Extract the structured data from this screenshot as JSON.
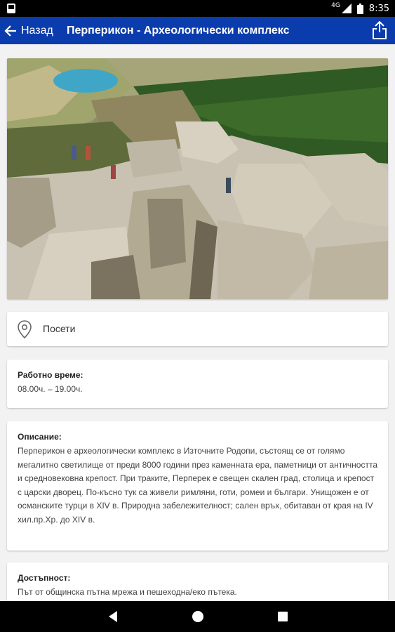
{
  "status_bar": {
    "time": "8:35",
    "network": "4G",
    "left_icon": "notification-icon",
    "icons": [
      "signal-icon",
      "battery-icon"
    ]
  },
  "app_bar": {
    "back_label": "Назад",
    "title": "Перперикон - Археологически комплекс",
    "share_icon": "share-icon",
    "color": "#0b3cae"
  },
  "photo": {
    "subject": "Perperikon archaeological complex rock ruins photo"
  },
  "visit": {
    "icon": "location-pin-icon",
    "label": "Посети"
  },
  "hours": {
    "title": "Работно време:",
    "text": "08.00ч. – 19.00ч."
  },
  "description": {
    "title": "Описание:",
    "text": "Перперикон е археологически комплекс в Източните Родопи, състоящ се от голямо мегалитно светилище от преди 8000 години през каменната ера, паметници от античността и средновековна крепост. При траките, Перперек е свещен скален град, столица и крепост с царски дворец. По-късно тук са живели римляни, готи, ромеи и българи. Унищожен е от османските турци в XIV в. Природна забележителност; сален връх, обитаван от края на IV хил.пр.Хр. до XIV в."
  },
  "accessibility": {
    "title": "Достъпност:",
    "text": "Път от общинска пътна мрежа и пешеходна/еко пътека."
  },
  "nav_bar": {
    "buttons": [
      "back-triangle-icon",
      "home-circle-icon",
      "recents-square-icon"
    ]
  }
}
